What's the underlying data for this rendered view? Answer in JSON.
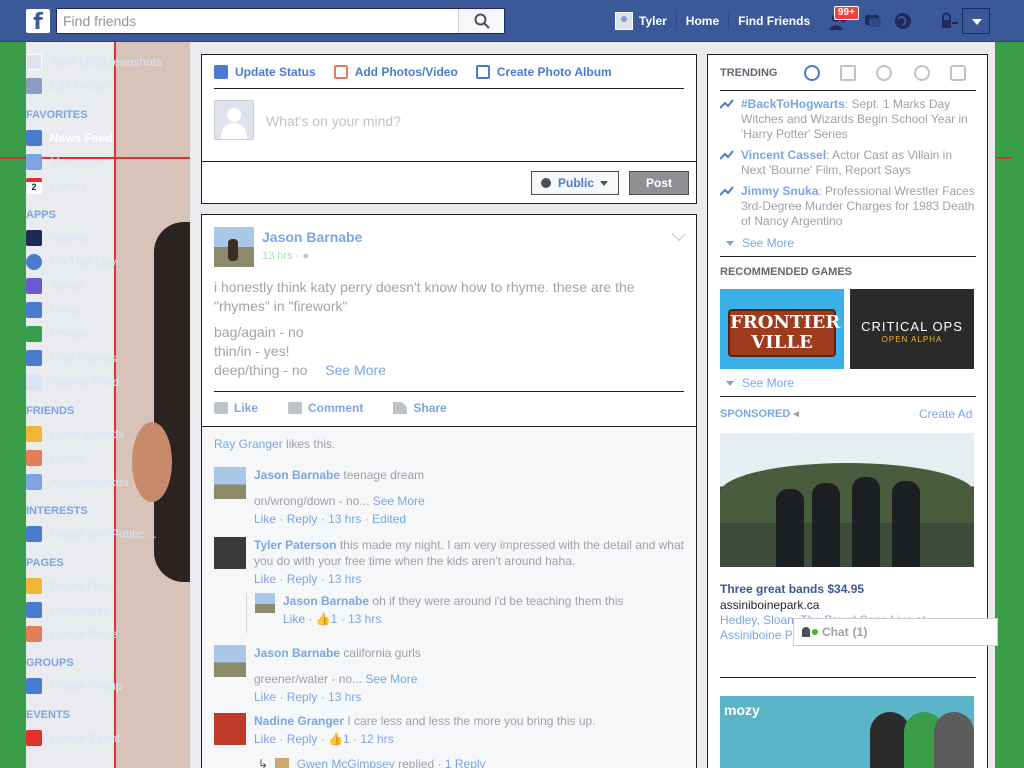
{
  "topbar": {
    "logo": "f",
    "search_placeholder": "Find friends",
    "user_name": "Tyler",
    "home": "Home",
    "find_friends": "Find Friends",
    "friend_requests_badge": "99+",
    "icons": [
      "friend-requests-icon",
      "messages-icon",
      "notifications-globe-icon",
      "privacy-icon",
      "account-menu-icon"
    ]
  },
  "leftnav": {
    "profile_name": "Tyler McScreenshots",
    "edit_profile": "Edit Profile",
    "sections": {
      "favorites": "FAVORITES",
      "apps": "APPS",
      "friends": "FRIENDS",
      "interests": "INTERESTS",
      "pages": "PAGES",
      "groups": "GROUPS",
      "events": "EVENTS"
    },
    "favorites": [
      "News Feed",
      "Messages",
      "Events"
    ],
    "events_date": "2",
    "apps": [
      "Games",
      "On This Day",
      "Saved",
      "Pokes",
      "Photos",
      "Find Friends",
      "Games Feed"
    ],
    "friends": [
      "Close Friends",
      "Family",
      "Acquaintances"
    ],
    "interests": [
      "Pages and Public ..."
    ],
    "pages": [
      "Pages Feed",
      "Like Pages",
      "Create Page"
    ],
    "groups": [
      "Create Group"
    ],
    "events": [
      "Create Event"
    ]
  },
  "composer": {
    "tab_status": "Update Status",
    "tab_photos": "Add Photos/Video",
    "tab_album": "Create Photo Album",
    "placeholder": "What's on your mind?",
    "privacy": "Public",
    "post": "Post"
  },
  "post": {
    "author": "Jason Barnabe",
    "time": "13 hrs",
    "text_1": "i honestly think katy perry doesn't know how to rhyme. these are the \"rhymes\" in \"firework\"",
    "text_2": "bag/again - no",
    "text_3": "thin/in - yes!",
    "text_4": "deep/thing - no",
    "see_more": "See More",
    "like": "Like",
    "comment": "Comment",
    "share": "Share",
    "likes_name": "Ray Granger",
    "likes_suffix": "likes this."
  },
  "comments": [
    {
      "author": "Jason Barnabe",
      "text": "teenage dream",
      "text2": "on/wrong/down - no...",
      "see_more": "See More",
      "like": "Like",
      "reply": "Reply",
      "time": "13 hrs",
      "extra": "Edited"
    },
    {
      "author": "Tyler Paterson",
      "text": "this made my night. I am very impressed with the detail and what you do with your free time when the kids aren't around haha.",
      "like": "Like",
      "reply": "Reply",
      "time": "13 hrs"
    },
    {
      "author": "Jason Barnabe",
      "text": "oh if they were around i'd be teaching them this",
      "like": "Like",
      "count": "1",
      "time": "13 hrs"
    },
    {
      "author": "Jason Barnabe",
      "text": "california gurls",
      "text2": "greener/water - no...",
      "see_more": "See More",
      "like": "Like",
      "reply": "Reply",
      "time": "13 hrs"
    },
    {
      "author": "Nadine Granger",
      "text": "I care less and less the more you bring this up.",
      "like": "Like",
      "reply": "Reply",
      "count": "1",
      "time": "12 hrs"
    },
    {
      "author": "Gwen McGimpsey",
      "text": "replied",
      "replies": "1 Reply"
    }
  ],
  "rightcol": {
    "trending": "TRENDING",
    "trends": [
      {
        "title": "#BackToHogwarts",
        "desc": ": Sept. 1 Marks Day Witches and Wizards Begin School Year in 'Harry Potter' Series"
      },
      {
        "title": "Vincent Cassel",
        "desc": ": Actor Cast as Villain in Next 'Bourne' Film, Report Says"
      },
      {
        "title": "Jimmy Snuka",
        "desc": ": Professional Wrestler Faces 3rd-Degree Murder Charges for 1983 Death of Nancy Argentino"
      }
    ],
    "see_more": "See More",
    "recommended_games": "RECOMMENDED GAMES",
    "game1": "FRONTIER VILLE",
    "game2": "CRITICAL OPS",
    "game2_sub": "OPEN ALPHA",
    "sponsored": "SPONSORED",
    "create_ad": "Create Ad",
    "ad1_title": "Three great bands $34.95",
    "ad1_url": "assiniboinepark.ca",
    "ad1_desc": "Hedley, Sloan, The Proud Sons Live at Assiniboine Park. Get your tickets now.",
    "ad2_logo": "mozy"
  },
  "chat": {
    "label": "Chat",
    "count": "(1)"
  },
  "colors": {
    "brand": "#3b5998",
    "link": "#7ba6e3",
    "green_bg": "#3a9d4a",
    "red_line": "#e0302f"
  }
}
